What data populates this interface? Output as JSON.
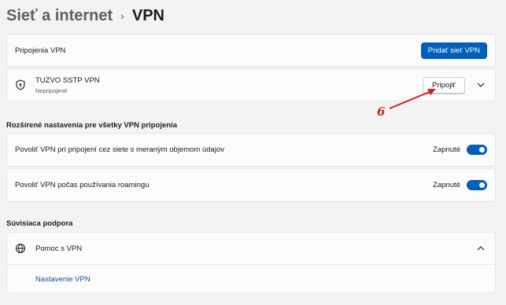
{
  "breadcrumb": {
    "parent": "Sieť a internet",
    "separator": "›",
    "current": "VPN"
  },
  "vpn_connections": {
    "label": "Pripojenia VPN",
    "add_button": "Pridať sieť VPN"
  },
  "vpn_item": {
    "name": "TUZVO SSTP VPN",
    "status": "Nepripojené",
    "connect_button": "Pripojiť",
    "icon": "shield-icon"
  },
  "advanced": {
    "title": "Rozšírené nastavenia pre všetky VPN pripojenia",
    "settings": [
      {
        "label": "Povoliť VPN pri pripojení cez siete s meraným objemom údajov",
        "state": "Zapnuté",
        "on": true
      },
      {
        "label": "Povoliť VPN počas používania roamingu",
        "state": "Zapnuté",
        "on": true
      }
    ]
  },
  "related": {
    "title": "Súvisiaca podpora",
    "help_label": "Pomoc s VPN",
    "help_icon": "globe-icon",
    "link": "Nastavenie VPN"
  },
  "annotation": {
    "number": "6",
    "color": "#d21f1f"
  },
  "colors": {
    "accent": "#005fb8",
    "background": "#f3f3f3",
    "card": "#fbfbfb"
  }
}
